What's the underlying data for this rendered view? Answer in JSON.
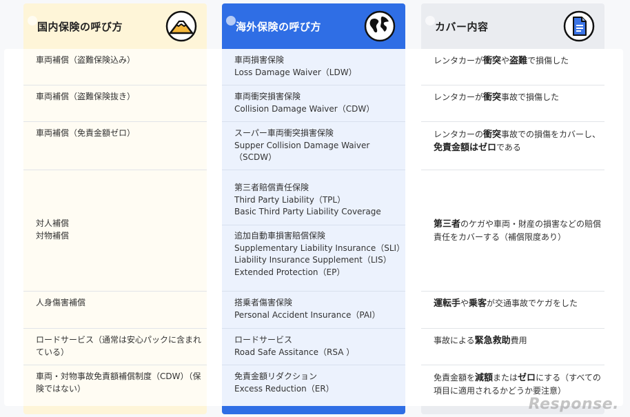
{
  "headers": {
    "domestic": "国内保険の呼び方",
    "overseas": "海外保険の呼び方",
    "coverage": "カバー内容"
  },
  "rows": [
    {
      "domestic": [
        "車両補償（盗難保険込み）"
      ],
      "overseas": [
        "車両損害保険",
        "Loss Damage Waiver（LDW）"
      ],
      "coverage": [
        [
          "レンタカーが",
          ""
        ],
        [
          "衝突",
          "b"
        ],
        [
          "や",
          ""
        ],
        [
          "盗難",
          "b"
        ],
        [
          "で損傷した",
          ""
        ]
      ]
    },
    {
      "domestic": [
        "車両補償（盗難保険抜き）"
      ],
      "overseas": [
        "車両衝突損害保険",
        "Collision Damage Waiver（CDW）"
      ],
      "coverage": [
        [
          "レンタカーが",
          ""
        ],
        [
          "衝突",
          "b"
        ],
        [
          "事故で損傷した",
          ""
        ]
      ]
    },
    {
      "domestic": [
        "車両補償（免責金額ゼロ）"
      ],
      "overseas": [
        "スーパー車両衝突損害保険",
        "Supper Collision Damage Waiver",
        "（SCDW）"
      ],
      "coverage_lines": [
        [
          [
            "レンタカーの",
            ""
          ],
          [
            "衝突",
            "b"
          ],
          [
            "事故での損傷をカバーし、",
            ""
          ]
        ],
        [
          [
            "免責金額はゼロ",
            "b"
          ],
          [
            "である",
            ""
          ]
        ]
      ]
    },
    {
      "domestic": [
        "対人補償",
        "対物補償"
      ],
      "overseas_a": [
        "第三者賠償責任保険",
        "Third Party Liability（TPL）",
        "Basic Third Party Liability Coverage"
      ],
      "overseas_b": [
        "追加自動車損害賠償保険",
        "Supplementary Liability Insurance（SLI）",
        "Liability Insurance Supplement（LIS）",
        "Extended Protection（EP）"
      ],
      "coverage_lines": [
        [
          [
            "第三者",
            "b"
          ],
          [
            "のケガや車両・財産の損害などの賠償",
            ""
          ]
        ],
        [
          [
            "責任をカバーする（補償限度あり）",
            ""
          ]
        ]
      ]
    },
    {
      "domestic": [
        "人身傷害補償"
      ],
      "overseas": [
        "搭乗者傷害保険",
        "Personal Accident Insurance（PAI）"
      ],
      "coverage": [
        [
          "運転手",
          "b"
        ],
        [
          "や",
          ""
        ],
        [
          "乗客",
          "b"
        ],
        [
          "が交通事故でケガをした",
          ""
        ]
      ]
    },
    {
      "domestic": [
        "ロードサービス（通常は安心パックに含まれ",
        "ている）"
      ],
      "overseas": [
        "ロードサービス",
        "Road Safe Assitance（RSA ）"
      ],
      "coverage": [
        [
          "事故による",
          ""
        ],
        [
          "緊急救助",
          "b"
        ],
        [
          "費用",
          ""
        ]
      ]
    },
    {
      "domestic": [
        "車両・対物事故免責額補償制度（CDW）（保",
        "険ではない）"
      ],
      "overseas": [
        "免責金額リダクション",
        "Excess Reduction（ER）"
      ],
      "coverage_lines": [
        [
          [
            "免責金額を",
            ""
          ],
          [
            "減額",
            "b"
          ],
          [
            "または",
            ""
          ],
          [
            "ゼロ",
            "b"
          ],
          [
            "にする（すべての",
            ""
          ]
        ],
        [
          [
            "項目に適用されるかどうか要注意）",
            ""
          ]
        ]
      ]
    }
  ],
  "icons": {
    "domestic": "mount-fuji-icon",
    "overseas": "globe-icon",
    "coverage": "document-icon"
  },
  "watermark": "Response.",
  "colors": {
    "domestic_header": "#fef5d8",
    "overseas_header": "#2f6ee5",
    "coverage_header": "#eaecf0"
  }
}
